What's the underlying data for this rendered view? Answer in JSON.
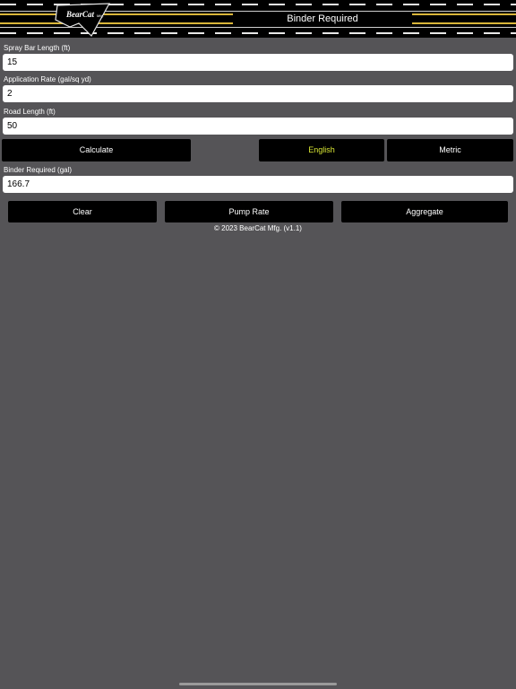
{
  "header": {
    "title": "Binder Required",
    "logo_text": "BearCat Mfg."
  },
  "form": {
    "spray_bar_length": {
      "label": "Spray Bar Length  (ft)",
      "value": "15"
    },
    "application_rate": {
      "label": "Application Rate  (gal/sq yd)",
      "value": "2"
    },
    "road_length": {
      "label": "Road Length  (ft)",
      "value": "50"
    }
  },
  "actions": {
    "calculate_label": "Calculate",
    "english_label": "English",
    "metric_label": "Metric",
    "selected_unit": "English"
  },
  "result": {
    "label": "Binder Required  (gal)",
    "value": "166.7"
  },
  "nav": {
    "clear_label": "Clear",
    "pump_rate_label": "Pump Rate",
    "aggregate_label": "Aggregate"
  },
  "footer": {
    "copyright": "© 2023 BearCat Mfg. (v1.1)"
  },
  "colors": {
    "background": "#555457",
    "button": "#000000",
    "active_text": "#d7e534",
    "road_yellow": "#d9b63a"
  }
}
